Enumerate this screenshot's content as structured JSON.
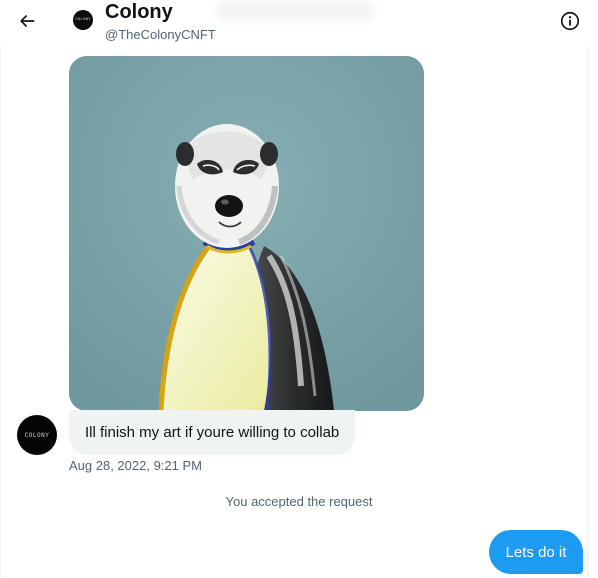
{
  "header": {
    "name": "Colony",
    "handle": "@TheColonyCNFT",
    "avatar_text": "COLONY",
    "back_icon": "arrow-left-icon",
    "info_icon": "info-circle-icon"
  },
  "conversation": {
    "incoming_text": "Ill finish my art if youre willing to collab",
    "incoming_avatar_text": "COLONY",
    "timestamp": "Aug 28, 2022, 9:21 PM",
    "system_message": "You accepted the request",
    "outgoing_text": "Lets do it"
  },
  "colors": {
    "accent": "#1d9bf0",
    "incoming_bubble": "#eff3f4",
    "secondary_text": "#536471",
    "image_background": "#79a0a6"
  }
}
